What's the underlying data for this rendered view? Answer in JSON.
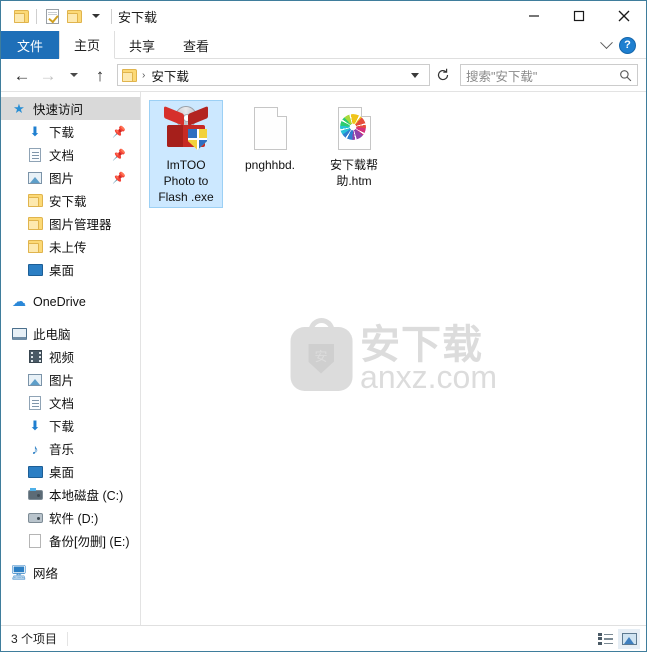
{
  "window": {
    "title": "安下载",
    "quick_access_toolbar": [
      {
        "name": "folder-properties-folder-icon",
        "icon": "folder-icon"
      },
      {
        "name": "properties",
        "icon": "properties-icon"
      },
      {
        "name": "new-folder",
        "icon": "new-folder-icon"
      },
      {
        "name": "customize-qat",
        "icon": "chevron-down-icon"
      }
    ],
    "caption_buttons": {
      "minimize": "—",
      "maximize": "□",
      "close": "✕"
    }
  },
  "ribbon": {
    "tabs": [
      {
        "label": "文件",
        "state": "file-menu"
      },
      {
        "label": "主页",
        "state": "active"
      },
      {
        "label": "共享",
        "state": "normal"
      },
      {
        "label": "查看",
        "state": "normal"
      }
    ],
    "expand_label": "",
    "help_label": "?"
  },
  "navigation": {
    "back_icon": "arrow-left-icon",
    "forward_icon": "arrow-right-icon",
    "recent_icon": "chevron-down-icon",
    "up_icon": "arrow-up-icon",
    "address": {
      "folder_icon": "folder-icon",
      "separator": "›",
      "crumb": "安下载",
      "dropdown_icon": "chevron-down-icon",
      "refresh_icon": "refresh-icon"
    },
    "search": {
      "placeholder": "搜索\"安下载\"",
      "icon": "search-icon"
    }
  },
  "sidebar": {
    "groups": [
      {
        "items": [
          {
            "label": "快速访问",
            "icon": "star-pin-icon",
            "indent": 0,
            "selected": true,
            "pinned": false
          },
          {
            "label": "下载",
            "icon": "download-icon",
            "indent": 1,
            "selected": false,
            "pinned": true
          },
          {
            "label": "文档",
            "icon": "document-icon",
            "indent": 1,
            "selected": false,
            "pinned": true
          },
          {
            "label": "图片",
            "icon": "pictures-icon",
            "indent": 1,
            "selected": false,
            "pinned": true
          },
          {
            "label": "安下载",
            "icon": "folder-icon",
            "indent": 1,
            "selected": false,
            "pinned": false
          },
          {
            "label": "图片管理器",
            "icon": "folder-icon",
            "indent": 1,
            "selected": false,
            "pinned": false
          },
          {
            "label": "未上传",
            "icon": "folder-icon",
            "indent": 1,
            "selected": false,
            "pinned": false
          },
          {
            "label": "桌面",
            "icon": "desktop-icon",
            "indent": 1,
            "selected": false,
            "pinned": false
          }
        ]
      },
      {
        "items": [
          {
            "label": "OneDrive",
            "icon": "onedrive-icon",
            "indent": 0,
            "selected": false,
            "pinned": false
          }
        ]
      },
      {
        "items": [
          {
            "label": "此电脑",
            "icon": "this-pc-icon",
            "indent": 0,
            "selected": false,
            "pinned": false
          },
          {
            "label": "视频",
            "icon": "videos-icon",
            "indent": 1,
            "selected": false,
            "pinned": false
          },
          {
            "label": "图片",
            "icon": "pictures-icon",
            "indent": 1,
            "selected": false,
            "pinned": false
          },
          {
            "label": "文档",
            "icon": "document-icon",
            "indent": 1,
            "selected": false,
            "pinned": false
          },
          {
            "label": "下载",
            "icon": "download-icon",
            "indent": 1,
            "selected": false,
            "pinned": false
          },
          {
            "label": "音乐",
            "icon": "music-icon",
            "indent": 1,
            "selected": false,
            "pinned": false
          },
          {
            "label": "桌面",
            "icon": "desktop-icon",
            "indent": 1,
            "selected": false,
            "pinned": false
          },
          {
            "label": "本地磁盘 (C:)",
            "icon": "system-drive-icon",
            "indent": 1,
            "selected": false,
            "pinned": false
          },
          {
            "label": "软件 (D:)",
            "icon": "drive-icon",
            "indent": 1,
            "selected": false,
            "pinned": false
          },
          {
            "label": "备份[勿删] (E:)",
            "icon": "drive-page-icon",
            "indent": 1,
            "selected": false,
            "pinned": false
          }
        ]
      },
      {
        "items": [
          {
            "label": "网络",
            "icon": "network-icon",
            "indent": 0,
            "selected": false,
            "pinned": false
          }
        ]
      }
    ]
  },
  "files": [
    {
      "name": "ImTOO Photo to Flash .exe",
      "icon": "exe-icon",
      "selected": true
    },
    {
      "name": "pnghhbd.",
      "icon": "blank-page-icon",
      "selected": false
    },
    {
      "name": "安下载帮助.htm",
      "icon": "html-document-icon",
      "selected": false
    }
  ],
  "watermark": {
    "logo_glyph": "安",
    "cn_text": "安下载",
    "en_text": "anxz.com",
    "color": "#dcdcdc"
  },
  "statusbar": {
    "item_count": "3 个项目",
    "views": [
      {
        "name": "details-view",
        "selected": false
      },
      {
        "name": "large-icons-view",
        "selected": true
      }
    ]
  },
  "colors": {
    "accent_blue": "#1e6fb8",
    "selection_blue": "#cce8ff",
    "window_border": "#3f7d9c",
    "sidebar_selected": "#d9d9d9"
  }
}
